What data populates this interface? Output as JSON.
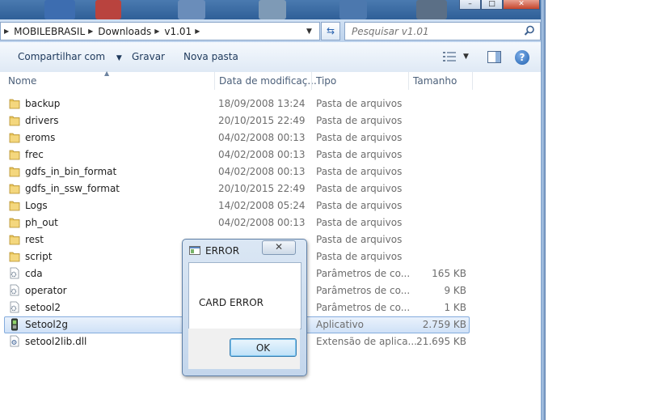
{
  "address": {
    "crumbs": [
      "MOBILEBRASIL",
      "Downloads",
      "v1.01"
    ]
  },
  "search": {
    "placeholder": "Pesquisar v1.01"
  },
  "toolbar": {
    "share_label": "Compartilhar com",
    "burn_label": "Gravar",
    "new_folder_label": "Nova pasta"
  },
  "columns": {
    "name": "Nome",
    "date": "Data de modificaç...",
    "type": "Tipo",
    "size": "Tamanho"
  },
  "files": [
    {
      "name": "backup",
      "date": "18/09/2008 13:24",
      "type": "Pasta de arquivos",
      "size": "",
      "icon": "folder-icon"
    },
    {
      "name": "drivers",
      "date": "20/10/2015 22:49",
      "type": "Pasta de arquivos",
      "size": "",
      "icon": "folder-icon"
    },
    {
      "name": "eroms",
      "date": "04/02/2008 00:13",
      "type": "Pasta de arquivos",
      "size": "",
      "icon": "folder-icon"
    },
    {
      "name": "frec",
      "date": "04/02/2008 00:13",
      "type": "Pasta de arquivos",
      "size": "",
      "icon": "folder-icon"
    },
    {
      "name": "gdfs_in_bin_format",
      "date": "04/02/2008 00:13",
      "type": "Pasta de arquivos",
      "size": "",
      "icon": "folder-icon"
    },
    {
      "name": "gdfs_in_ssw_format",
      "date": "20/10/2015 22:49",
      "type": "Pasta de arquivos",
      "size": "",
      "icon": "folder-icon"
    },
    {
      "name": "Logs",
      "date": "14/02/2008 05:24",
      "type": "Pasta de arquivos",
      "size": "",
      "icon": "folder-icon"
    },
    {
      "name": "ph_out",
      "date": "04/02/2008 00:13",
      "type": "Pasta de arquivos",
      "size": "",
      "icon": "folder-icon"
    },
    {
      "name": "rest",
      "date": "",
      "type": "Pasta de arquivos",
      "size": "",
      "icon": "folder-icon"
    },
    {
      "name": "script",
      "date": "",
      "type": "Pasta de arquivos",
      "size": "",
      "icon": "folder-icon"
    },
    {
      "name": "cda",
      "date": "",
      "type": "Parâmetros de co...",
      "size": "165 KB",
      "icon": "config-file-icon"
    },
    {
      "name": "operator",
      "date": "",
      "type": "Parâmetros de co...",
      "size": "9 KB",
      "icon": "config-file-icon"
    },
    {
      "name": "setool2",
      "date": "",
      "type": "Parâmetros de co...",
      "size": "1 KB",
      "icon": "config-file-icon"
    },
    {
      "name": "Setool2g",
      "date": "",
      "type": "Aplicativo",
      "size": "2.759 KB",
      "icon": "phone-app-icon",
      "selected": true
    },
    {
      "name": "setool2lib.dll",
      "date": "",
      "type": "Extensão de aplica...",
      "size": "21.695 KB",
      "icon": "dll-file-icon"
    }
  ],
  "dialog": {
    "title": "ERROR",
    "message": "CARD ERROR",
    "ok_label": "OK"
  },
  "colors": {
    "selection": "#cfe1f7",
    "header_text": "#4c607a",
    "folder": "#e8c45a"
  }
}
